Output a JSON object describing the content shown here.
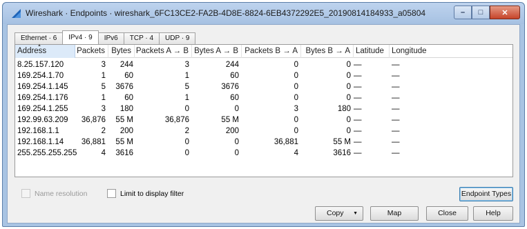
{
  "window": {
    "title": "Wireshark · Endpoints · wireshark_6FC13CE2-FA2B-4D8E-8824-6EB4372292E5_20190814184933_a05804",
    "controls": {
      "minimize": "–",
      "maximize": "□",
      "close": "✕"
    }
  },
  "tabs": [
    {
      "label": "Ethernet · 6"
    },
    {
      "label": "IPv4 · 9",
      "active": true
    },
    {
      "label": "IPv6"
    },
    {
      "label": "TCP · 4"
    },
    {
      "label": "UDP · 9"
    }
  ],
  "table": {
    "columns": [
      "Address",
      "Packets",
      "Bytes",
      "Packets A → B",
      "Bytes A → B",
      "Packets B → A",
      "Bytes B → A",
      "Latitude",
      "Longitude"
    ],
    "sorted_column": "Address",
    "rows": [
      [
        "8.25.157.120",
        "3",
        "244",
        "3",
        "244",
        "0",
        "0",
        "—",
        "—"
      ],
      [
        "169.254.1.70",
        "1",
        "60",
        "1",
        "60",
        "0",
        "0",
        "—",
        "—"
      ],
      [
        "169.254.1.145",
        "5",
        "3676",
        "5",
        "3676",
        "0",
        "0",
        "—",
        "—"
      ],
      [
        "169.254.1.176",
        "1",
        "60",
        "1",
        "60",
        "0",
        "0",
        "—",
        "—"
      ],
      [
        "169.254.1.255",
        "3",
        "180",
        "0",
        "0",
        "3",
        "180",
        "—",
        "—"
      ],
      [
        "192.99.63.209",
        "36,876",
        "55 M",
        "36,876",
        "55 M",
        "0",
        "0",
        "—",
        "—"
      ],
      [
        "192.168.1.1",
        "2",
        "200",
        "2",
        "200",
        "0",
        "0",
        "—",
        "—"
      ],
      [
        "192.168.1.14",
        "36,881",
        "55 M",
        "0",
        "0",
        "36,881",
        "55 M",
        "—",
        "—"
      ],
      [
        "255.255.255.255",
        "4",
        "3616",
        "0",
        "0",
        "4",
        "3616",
        "—",
        "—"
      ]
    ]
  },
  "options": {
    "name_resolution": {
      "label": "Name resolution",
      "checked": false,
      "enabled": false
    },
    "limit_filter": {
      "label": "Limit to display filter",
      "checked": false,
      "enabled": true
    }
  },
  "buttons": {
    "endpoint_types": "Endpoint Types",
    "copy": "Copy",
    "map": "Map",
    "close": "Close",
    "help": "Help"
  },
  "colors": {
    "title_bar": "#a9c4e3",
    "sorted_header": "#dceaf9",
    "close_button": "#c6442a"
  }
}
